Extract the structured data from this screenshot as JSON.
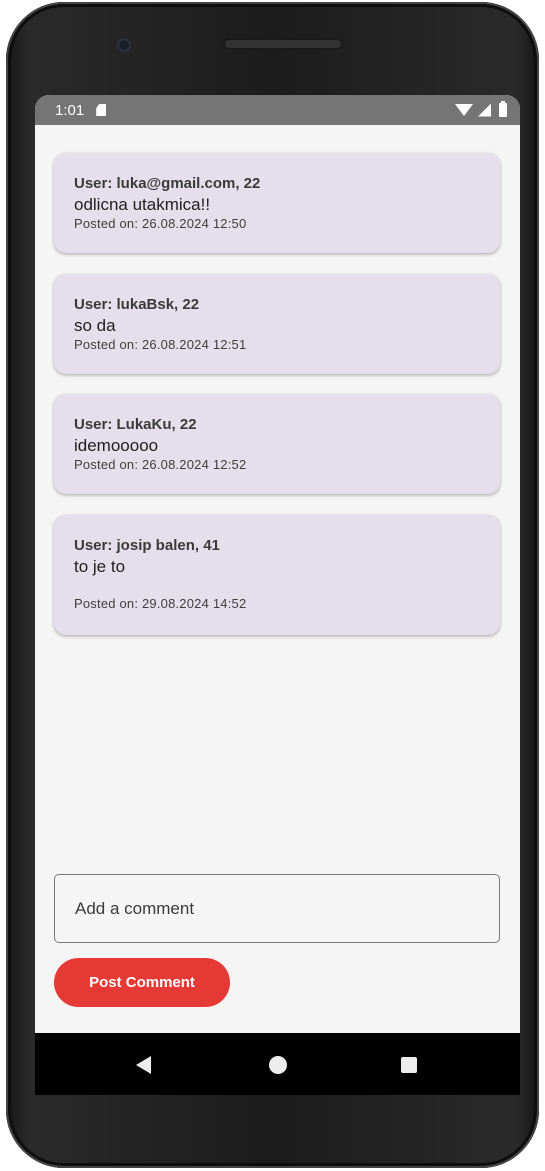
{
  "status_bar": {
    "time": "1:01",
    "icons": [
      "sd-card-icon",
      "wifi-icon",
      "signal-icon",
      "battery-icon"
    ]
  },
  "comments": [
    {
      "user": "User: luka@gmail.com, 22",
      "text": "odlicna utakmica!!",
      "posted": "Posted on: 26.08.2024 12:50"
    },
    {
      "user": "User: lukaBsk, 22",
      "text": "so da",
      "posted": "Posted on: 26.08.2024 12:51"
    },
    {
      "user": "User: LukaKu, 22",
      "text": "idemooooo",
      "posted": "Posted on: 26.08.2024 12:52"
    },
    {
      "user": "User: josip balen, 41",
      "text": "to je to",
      "posted": "Posted on: 29.08.2024 14:52"
    }
  ],
  "comment_input": {
    "placeholder": "Add a comment",
    "value": ""
  },
  "post_button": {
    "label": "Post Comment"
  },
  "colors": {
    "card_background": "#e5dfec",
    "accent": "#e53935",
    "status_bar": "#757575",
    "screen_background": "#f5f5f5"
  },
  "nav_bar": {
    "icons": [
      "back-icon",
      "home-icon",
      "recents-icon"
    ]
  }
}
